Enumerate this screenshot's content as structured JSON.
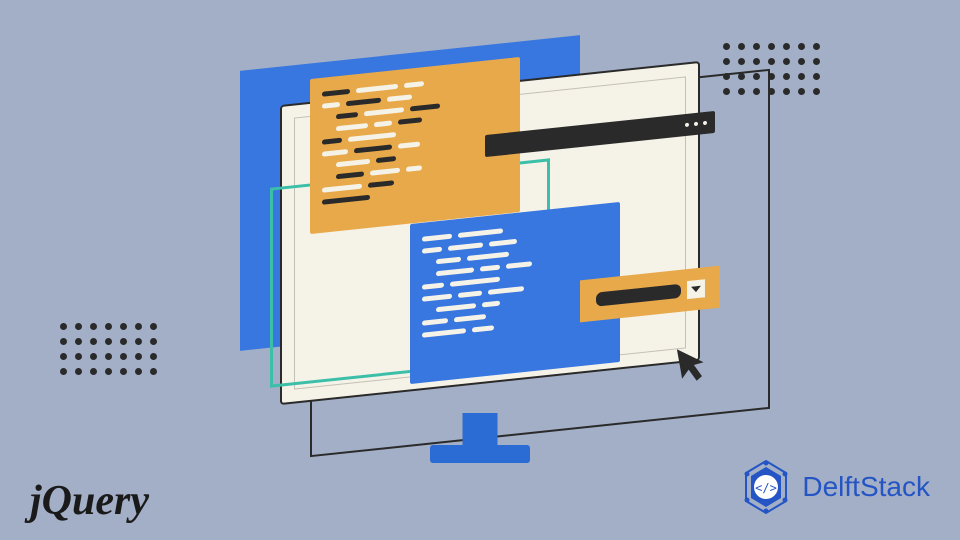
{
  "brand_left": "jQuery",
  "brand_right": "DelftStack",
  "colors": {
    "background": "#a2afc6",
    "panel_blue": "#3876e0",
    "panel_orange": "#e8a94a",
    "accent_teal": "#3bbfa8",
    "dark": "#2a2a2a",
    "cream": "#f5f2e8",
    "delft_blue": "#2555c4"
  },
  "illustration": {
    "description": "Stylized computer monitor with overlapping code editor windows in isometric skew",
    "windows": [
      "orange-code-panel",
      "blue-code-panel",
      "title-bar",
      "dropdown-control"
    ],
    "decorations": [
      "dot-grid-top-right",
      "dot-grid-mid-left",
      "cursor-arrow"
    ]
  }
}
